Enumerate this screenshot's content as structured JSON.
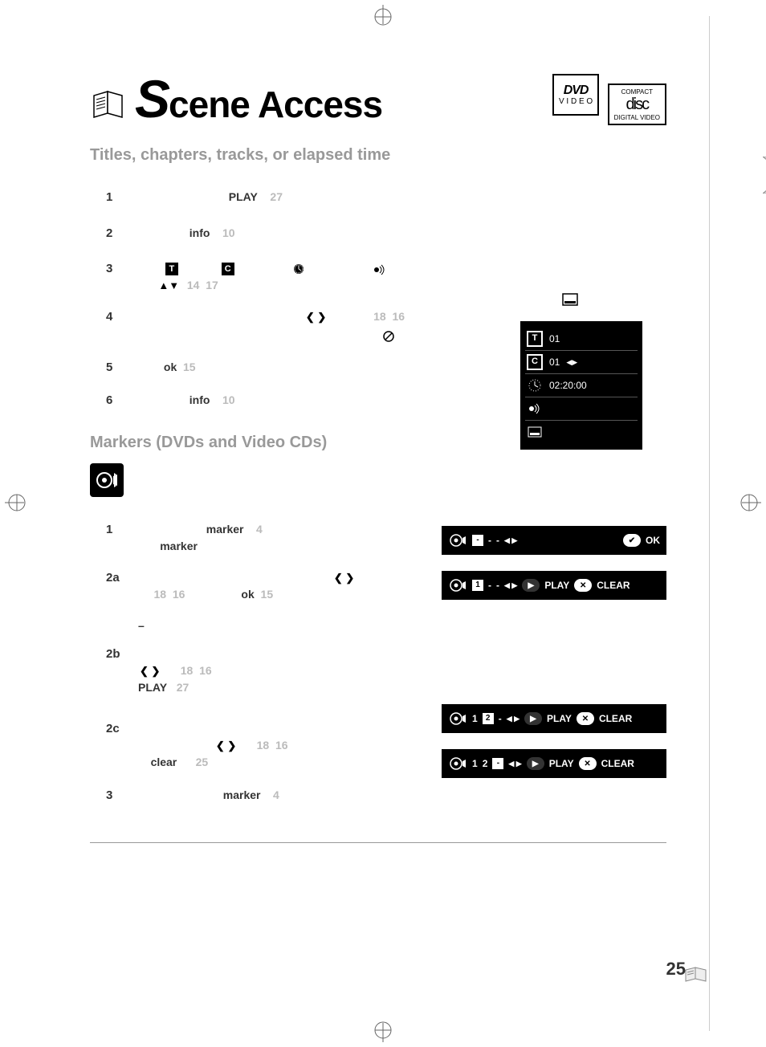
{
  "header": {
    "title_prefix_letter": "S",
    "title_rest": "cene Access"
  },
  "subtitle1": "Titles, chapters, tracks, or elapsed time",
  "subtitle2": "Markers (DVDs and Video CDs)",
  "gb_label": "GB",
  "steps1": {
    "r1": {
      "num": "1",
      "kw": "PLAY",
      "g": "27"
    },
    "r2": {
      "num": "2",
      "kw": "info",
      "g": "10"
    },
    "r3": {
      "num": "3",
      "iconT": "T",
      "iconC": "C",
      "a": "14",
      "b": "17"
    },
    "r4": {
      "num": "4",
      "a": "18",
      "b": "16"
    },
    "r5": {
      "num": "5",
      "kw": "ok",
      "g": "15"
    },
    "r6": {
      "num": "6",
      "kw": "info",
      "g": "10"
    }
  },
  "osd": {
    "t_label": "T",
    "t_val": "01",
    "c_label": "C",
    "c_val": "01",
    "c_arrows": "◀▶",
    "time": "02:20:00"
  },
  "markers": {
    "r1": {
      "num": "1",
      "kw1": "marker",
      "g1": "4",
      "kw2": "marker"
    },
    "r2a": {
      "num": "2a",
      "a": "18",
      "b": "16",
      "kw": "ok",
      "g": "15"
    },
    "dash": "–",
    "r2b": {
      "num": "2b",
      "a": "18",
      "b": "16",
      "kw": "PLAY",
      "g": "27"
    },
    "r2c": {
      "num": "2c",
      "a": "18",
      "b": "16",
      "kw": "clear",
      "g": "25"
    },
    "r3": {
      "num": "3",
      "kw": "marker",
      "g": "4"
    }
  },
  "markerbars": {
    "b1": {
      "d1": "-",
      "d2": "-",
      "d3": "-",
      "arrows": "◀ ▶",
      "btn": "OK"
    },
    "b2": {
      "d1": "1",
      "d2": "-",
      "d3": "-",
      "arrows": "◀ ▶",
      "btn1": "PLAY",
      "btn2": "CLEAR"
    },
    "b3": {
      "d1": "1",
      "d2": "2",
      "d3": "-",
      "arrows": "◀ ▶",
      "btn1": "PLAY",
      "btn2": "CLEAR"
    },
    "b4": {
      "d1": "1",
      "d2": "2",
      "d3": "-",
      "arrows": "◀ ▶",
      "btn1": "PLAY",
      "btn2": "CLEAR"
    }
  },
  "page_number": "25"
}
